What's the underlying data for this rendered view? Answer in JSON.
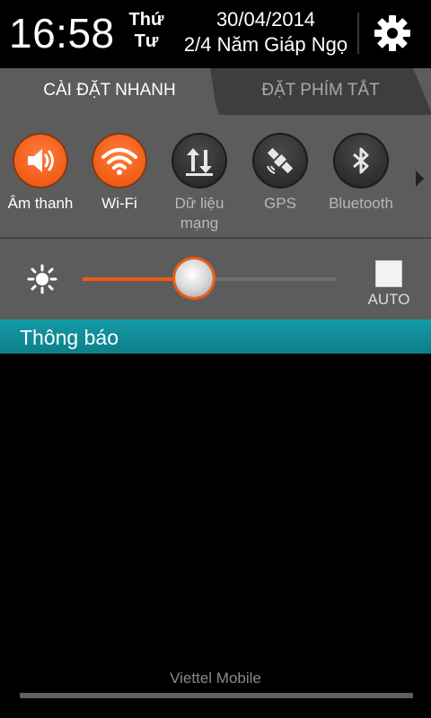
{
  "status": {
    "time": "16:58",
    "day_line1": "Thứ",
    "day_line2": "Tư",
    "date": "30/04/2014",
    "lunar_date": "2/4 Năm Giáp Ngọ",
    "settings_icon": "gear-icon"
  },
  "tabs": [
    {
      "label": "CÀI ĐẶT NHANH",
      "active": true
    },
    {
      "label": "ĐẶT PHÍM TẮT",
      "active": false
    }
  ],
  "toggles": [
    {
      "label": "Âm thanh",
      "icon": "speaker-icon",
      "on": true
    },
    {
      "label": "Wi-Fi",
      "icon": "wifi-icon",
      "on": true
    },
    {
      "label_line1": "Dữ liệu",
      "label_line2": "mạng",
      "icon": "mobile-data-icon",
      "on": false
    },
    {
      "label": "GPS",
      "icon": "satellite-icon",
      "on": false
    },
    {
      "label": "Bluetooth",
      "icon": "bluetooth-icon",
      "on": false
    }
  ],
  "brightness": {
    "icon": "sun-icon",
    "level_fraction": 0.44,
    "auto_label": "AUTO",
    "auto_checked": false
  },
  "notifications": {
    "header": "Thông báo"
  },
  "footer": {
    "carrier": "Viettel Mobile"
  },
  "colors": {
    "accent": "#f05a14",
    "notification_bar": "#0f8d99",
    "panel": "#5c5c5c"
  }
}
